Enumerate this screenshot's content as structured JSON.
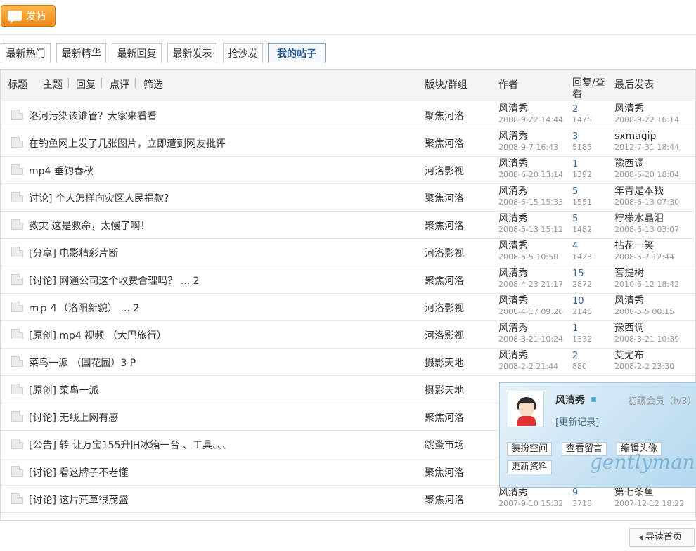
{
  "post_button": {
    "label": "发帖"
  },
  "tabs": [
    {
      "label": "最新热门"
    },
    {
      "label": "最新精华"
    },
    {
      "label": "最新回复"
    },
    {
      "label": "最新发表"
    },
    {
      "label": "抢沙发"
    },
    {
      "label": "我的帖子"
    }
  ],
  "header": {
    "title": "标题",
    "filter_topic": "主题",
    "filter_reply": "回复",
    "filter_comment": "点评",
    "filter_select": "筛选",
    "forum": "版块/群组",
    "author": "作者",
    "replies": "回复/查看",
    "last": "最后发表"
  },
  "rows": [
    {
      "title": "洛河污染该谁管？大家来看看",
      "forum": "聚焦河洛",
      "author": "风清秀",
      "date": "2008-9-22 14:44",
      "replies": "2",
      "views": "1475",
      "last_user": "风清秀",
      "last_date": "2008-9-22 16:14"
    },
    {
      "title": "在钓鱼网上发了几张图片，立即遭到网友批评",
      "forum": "聚焦河洛",
      "author": "风清秀",
      "date": "2008-9-7 16:43",
      "replies": "3",
      "views": "5185",
      "last_user": "sxmagip",
      "last_date": "2012-7-31 18:44"
    },
    {
      "title": "mp4 垂钓春秋",
      "forum": "河洛影视",
      "author": "风清秀",
      "date": "2008-6-20 13:14",
      "replies": "1",
      "views": "1392",
      "last_user": "豫西调",
      "last_date": "2008-6-20 18:04"
    },
    {
      "title": "讨论] 个人怎样向灾区人民捐款？",
      "forum": "聚焦河洛",
      "author": "风清秀",
      "date": "2008-5-15 15:33",
      "replies": "5",
      "views": "1551",
      "last_user": "年青是本钱",
      "last_date": "2008-6-13 07:30"
    },
    {
      "title": "救灾 这是救命，太慢了啊！",
      "forum": "聚焦河洛",
      "author": "风清秀",
      "date": "2008-5-13 15:12",
      "replies": "5",
      "views": "1482",
      "last_user": "柠檬水晶泪",
      "last_date": "2008-6-13 03:07"
    },
    {
      "title": "[分享] 电影精彩片断",
      "forum": "河洛影视",
      "author": "风清秀",
      "date": "2008-5-5 10:50",
      "replies": "4",
      "views": "1423",
      "last_user": "拈花一笑",
      "last_date": "2008-5-7 12:44"
    },
    {
      "title": "[讨论] 网通公司这个收费合理吗？ ... 2",
      "forum": "聚焦河洛",
      "author": "风清秀",
      "date": "2008-4-23 21:17",
      "replies": "15",
      "views": "2872",
      "last_user": "菩提树",
      "last_date": "2010-6-12 18:42"
    },
    {
      "title": "ｍｐ４（洛阳新貌） ... 2",
      "forum": "河洛影视",
      "author": "风清秀",
      "date": "2008-4-17 09:26",
      "replies": "10",
      "views": "2146",
      "last_user": "风清秀",
      "last_date": "2008-5-5 00:15"
    },
    {
      "title": "[原创] mp4 视频 （大巴旅行）",
      "forum": "河洛影视",
      "author": "风清秀",
      "date": "2008-3-21 10:24",
      "replies": "1",
      "views": "1332",
      "last_user": "豫西调",
      "last_date": "2008-3-21 10:39"
    },
    {
      "title": "菜鸟一派 （国花园）3 P",
      "forum": "摄影天地",
      "author": "风清秀",
      "date": "2008-2-2 21:44",
      "replies": "2",
      "views": "880",
      "last_user": "艾尤布",
      "last_date": "2008-2-2 23:30"
    },
    {
      "title": "[原创] 菜鸟一派",
      "forum": "摄影天地",
      "author": "",
      "date": "",
      "replies": "",
      "views": "",
      "last_user": "",
      "last_date": ""
    },
    {
      "title": "[讨论] 无线上网有感",
      "forum": "聚焦河洛",
      "author": "",
      "date": "",
      "replies": "",
      "views": "",
      "last_user": "",
      "last_date": ""
    },
    {
      "title": "[公告] 转 让万宝155升旧冰箱一台 、工具、、、",
      "forum": "跳蚤市场",
      "author": "",
      "date": "",
      "replies": "",
      "views": "",
      "last_user": "",
      "last_date": ""
    },
    {
      "title": "[讨论] 看这牌子不老懂",
      "forum": "聚焦河洛",
      "author": "",
      "date": "",
      "replies": "",
      "views": "",
      "last_user": "",
      "last_date": ""
    },
    {
      "title": "[讨论] 这片荒草很茂盛",
      "forum": "聚焦河洛",
      "author": "风清秀",
      "date": "2007-9-10 15:32",
      "replies": "9",
      "views": "3718",
      "last_user": "第七条鱼",
      "last_date": "2007-12-12 18:22"
    }
  ],
  "popup": {
    "username": "风清秀",
    "level": "初级会员（lv3）",
    "update_record": "[更新记录]",
    "btn_dress": "装扮空间",
    "btn_messages": "查看留言",
    "btn_avatar": "编辑头像",
    "btn_profile": "更新资料",
    "watermark": "gentlyman"
  },
  "footer": {
    "home_label": "导读首页"
  }
}
